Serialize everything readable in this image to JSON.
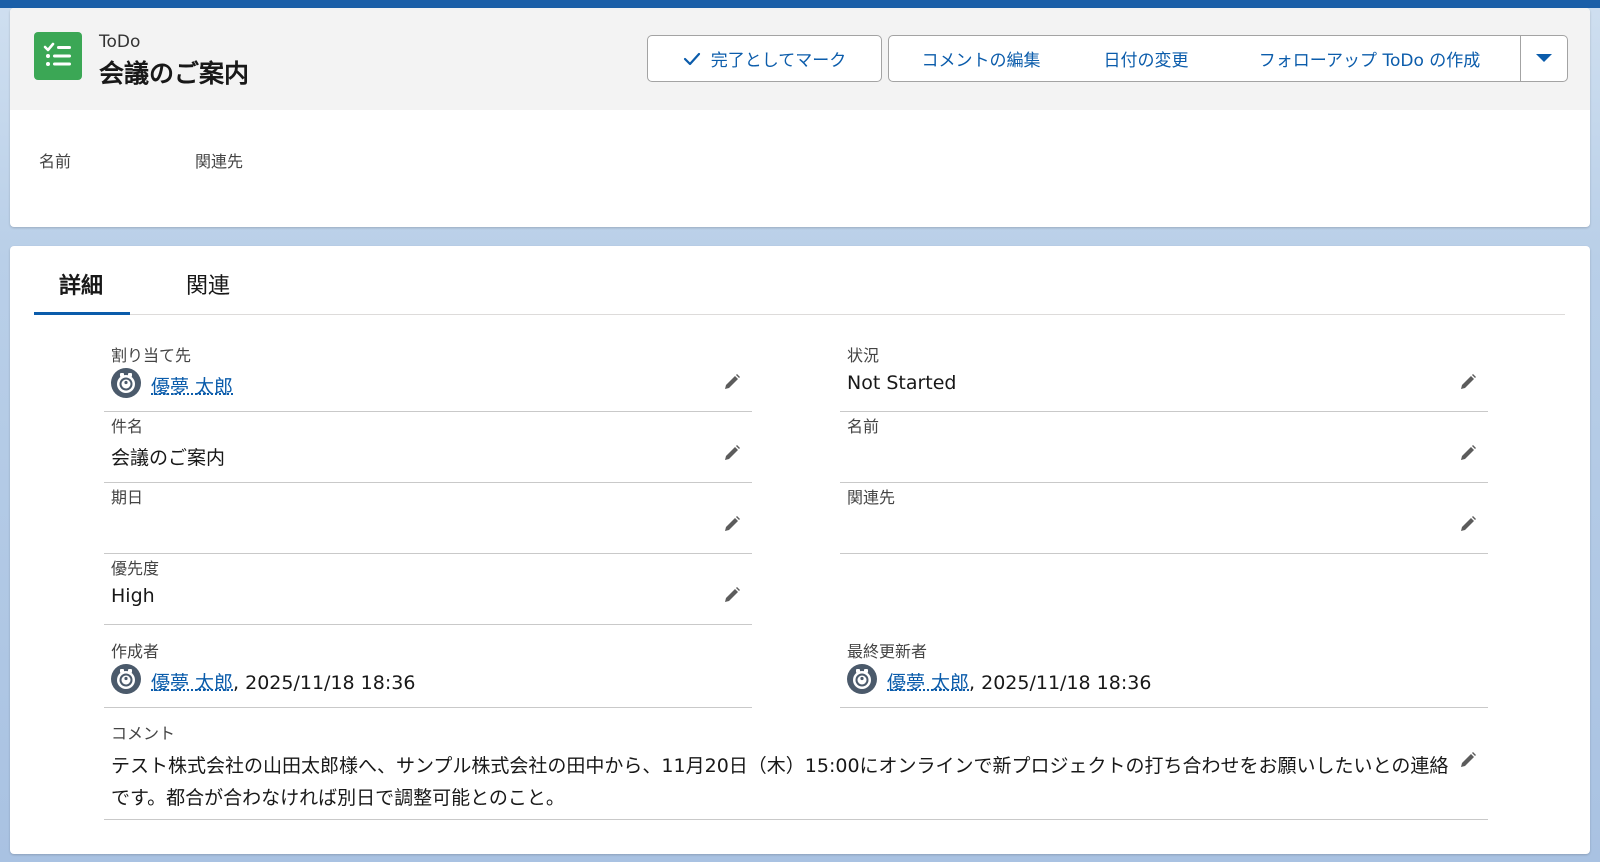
{
  "header": {
    "object_type": "ToDo",
    "title": "会議のご案内",
    "buttons": {
      "mark_complete": "完了としてマーク",
      "edit_comment": "コメントの編集",
      "change_date": "日付の変更",
      "create_followup": "フォローアップ ToDo の作成"
    },
    "highlight_fields": [
      "名前",
      "関連先"
    ]
  },
  "tabs": [
    "詳細",
    "関連"
  ],
  "details": {
    "assigned_to": {
      "label": "割り当て先",
      "value": "優夢 太郎"
    },
    "status": {
      "label": "状況",
      "value": "Not Started"
    },
    "subject": {
      "label": "件名",
      "value": "会議のご案内"
    },
    "name": {
      "label": "名前",
      "value": ""
    },
    "due_date": {
      "label": "期日",
      "value": ""
    },
    "related_to": {
      "label": "関連先",
      "value": ""
    },
    "priority": {
      "label": "優先度",
      "value": "High"
    },
    "created_by": {
      "label": "作成者",
      "user": "優夢 太郎",
      "date": ", 2025/11/18 18:36"
    },
    "last_modified_by": {
      "label": "最終更新者",
      "user": "優夢 太郎",
      "date": ", 2025/11/18 18:36"
    },
    "comment": {
      "label": "コメント",
      "value": "テスト株式会社の山田太郎様へ、サンプル株式会社の田中から、11月20日（木）15:00にオンラインで新プロジェクトの打ち合わせをお願いしたいとの連絡です。都合が合わなければ別日で調整可能とのこと。"
    }
  },
  "colors": {
    "brand_blue": "#0b5cab",
    "todo_green": "#3ba755"
  },
  "icons": [
    "todo-icon",
    "check-icon",
    "chevron-down-icon",
    "pencil-icon",
    "user-avatar-icon"
  ]
}
